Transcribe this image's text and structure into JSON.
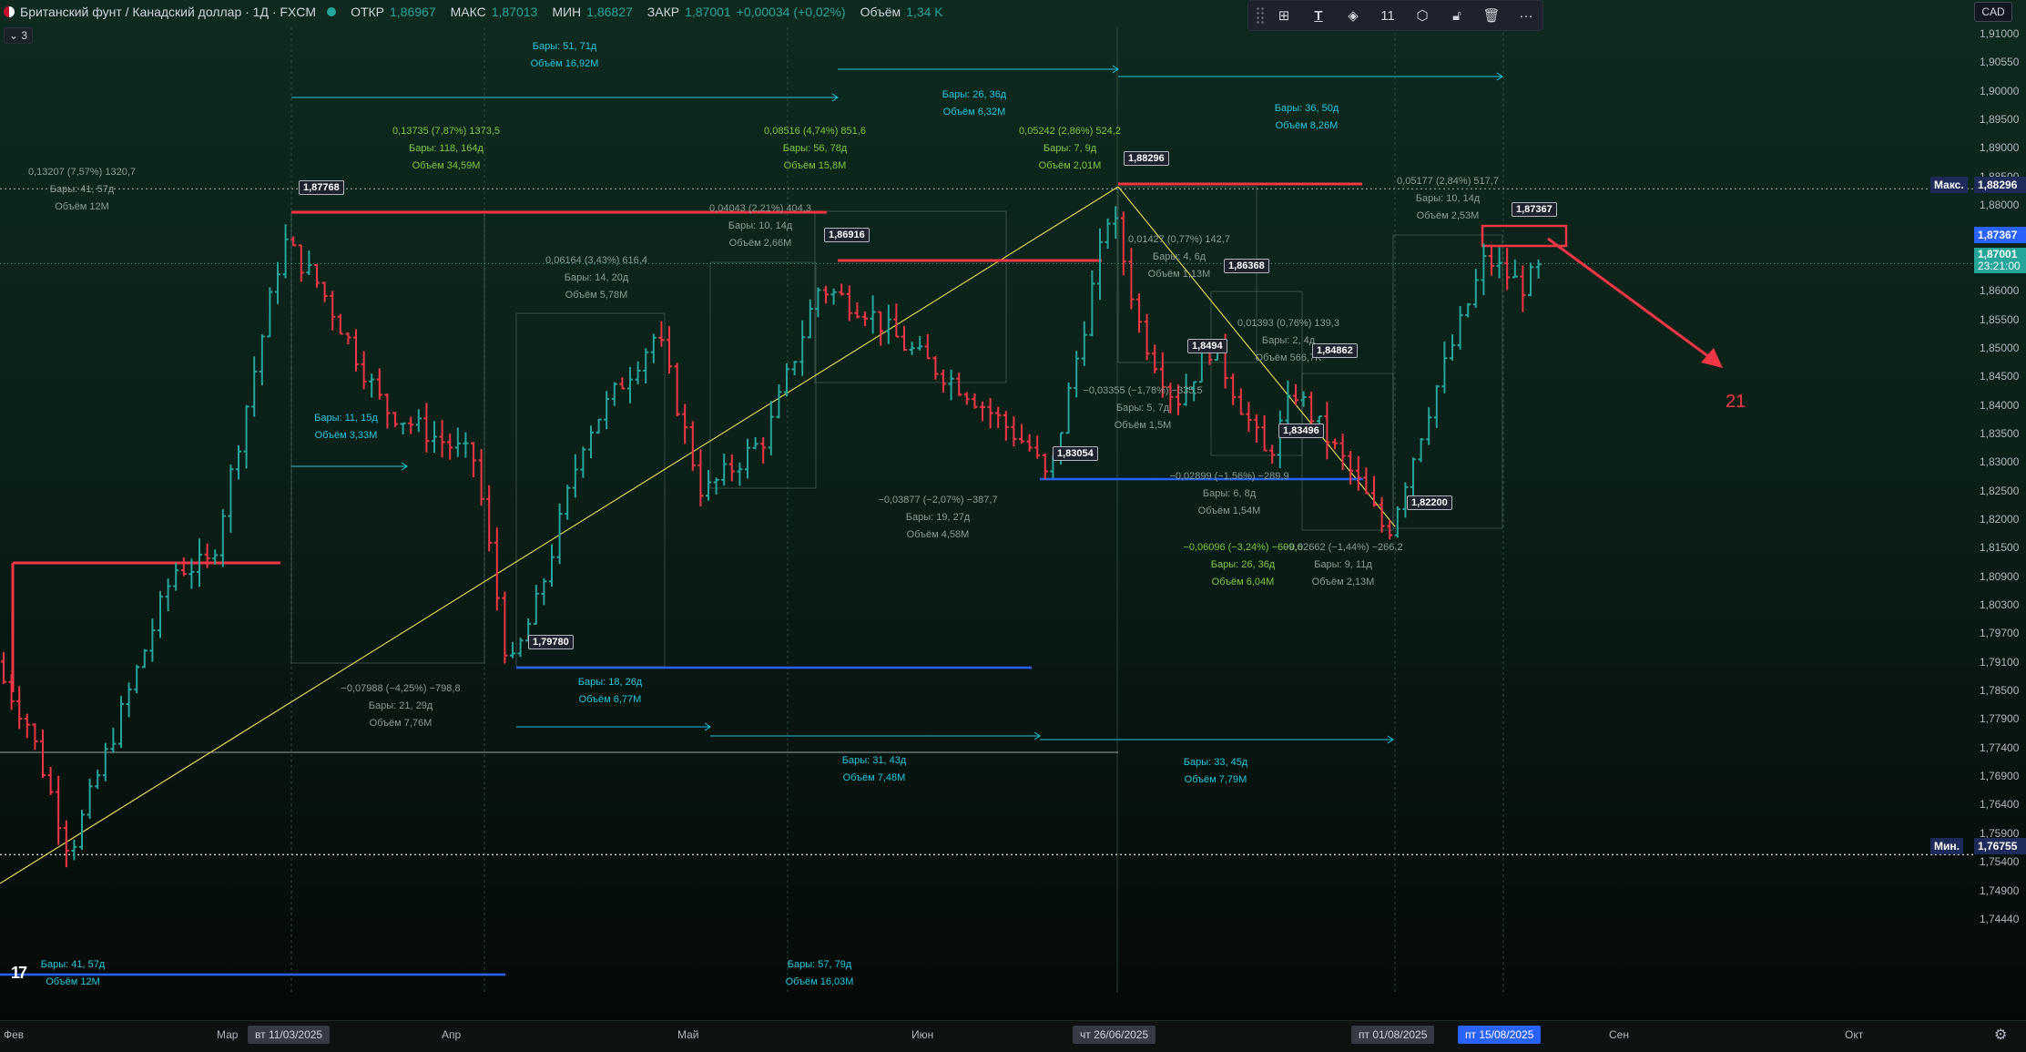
{
  "header": {
    "title": "Британский фунт / Канадский доллар · 1Д · FXCM",
    "open_label": "ОТКР",
    "open": "1,86967",
    "high_label": "МАКС",
    "high": "1,87013",
    "low_label": "МИН",
    "low": "1,86827",
    "close_label": "ЗАКР",
    "close": "1,87001",
    "change": "+0,00034 (+0,02%)",
    "volume_label": "Объём",
    "volume": "1,34 K",
    "indicator_count": "3"
  },
  "toolbar": {
    "count": "11",
    "icons": [
      "grip-icon",
      "template-icon",
      "text-tool-icon",
      "fill-icon",
      "line-width-icon",
      "settings-icon",
      "lock-icon",
      "trash-icon",
      "more-icon"
    ]
  },
  "price_scale": {
    "currency": "CAD",
    "ticks": [
      "1,91000",
      "1,90550",
      "1,90000",
      "1,89500",
      "1,89000",
      "1,88500",
      "1,88000",
      "1,87500",
      "1,86500",
      "1,86000",
      "1,85500",
      "1,85000",
      "1,84500",
      "1,84000",
      "1,83500",
      "1,83000",
      "1,82500",
      "1,82000",
      "1,81500",
      "1,80900",
      "1,80300",
      "1,79700",
      "1,79100",
      "1,78500",
      "1,77900",
      "1,77400",
      "1,76900",
      "1,76400",
      "1,75900",
      "1,75400",
      "1,74900",
      "1,74440"
    ],
    "max_label": "Макс.",
    "max_value": "1,88296",
    "min_label": "Мин.",
    "min_value": "1,76755",
    "current_price": "1,87001",
    "countdown": "23:21:00",
    "marked_price": "1,87367",
    "colors": {
      "current": "#26a69a",
      "marked": "#2962ff",
      "max": "#1e2a5a"
    }
  },
  "time_axis": {
    "labels": [
      "Фев",
      "Мар",
      "Апр",
      "Май",
      "Июн",
      "Сен",
      "Окт"
    ],
    "badges": [
      "вт 11/03/2025",
      "чт 26/06/2025",
      "пт 01/08/2025",
      "пт 15/08/2025"
    ]
  },
  "price_labels": [
    "1,87768",
    "1,86916",
    "1,88296",
    "1,86368",
    "1,8494",
    "1,84862",
    "1,83496",
    "1,83054",
    "1,82200",
    "1,79780",
    "1,87367"
  ],
  "annotations": {
    "a1": [
      "0,13207 (7,57%) 1320,7",
      "Бары: 41, 57д",
      "Объём 12M"
    ],
    "a2": [
      "0,13735 (7,87%) 1373,5",
      "Бары: 118, 164д",
      "Объём 34,59M"
    ],
    "a3": [
      "Бары: 51, 71д",
      "Объём 16,92M"
    ],
    "a4": [
      "0,08516 (4,74%) 851,6",
      "Бары: 56, 78д",
      "Объём 15,8M"
    ],
    "a5": [
      "Бары: 26, 36д",
      "Объём 6,32M"
    ],
    "a6": [
      "0,05242 (2,86%) 524,2",
      "Бары: 7, 9д",
      "Объём 2,01M"
    ],
    "a7": [
      "Бары: 36, 50д",
      "Объём 8,26M"
    ],
    "a8": [
      "0,05177 (2,84%) 517,7",
      "Бары: 10, 14д",
      "Объём 2,53M"
    ],
    "a9": [
      "0,04043 (2,21%) 404,3",
      "Бары: 10, 14д",
      "Объём 2,66M"
    ],
    "a10": [
      "0,06164 (3,43%) 616,4",
      "Бары: 14, 20д",
      "Объём 5,78M"
    ],
    "a11": [
      "0,01427 (0,77%) 142,7",
      "Бары: 4, 6д",
      "Объём 1,13M"
    ],
    "a12": [
      "0,01393 (0,76%) 139,3",
      "Бары: 2, 4д",
      "Объём 566,7K"
    ],
    "a13": [
      "Бары: 11, 15д",
      "Объём 3,33M"
    ],
    "a14": [
      "−0,03355 (−1,78%) −335,5",
      "Бары: 5, 7д",
      "Объём 1,5M"
    ],
    "a15": [
      "−0,03877 (−2,07%) −387,7",
      "Бары: 19, 27д",
      "Объём 4,58M"
    ],
    "a16": [
      "−0,02899 (−1,56%) −289,9",
      "Бары: 6, 8д",
      "Объём 1,54M"
    ],
    "a17": [
      "−0,06096 (−3,24%) −609,6",
      "Бары: 26, 36д",
      "Объём 6,04M"
    ],
    "a18": [
      "−0,02662 (−1,44%) −266,2",
      "Бары: 9, 11д",
      "Объём 2,13M"
    ],
    "a19": [
      "−0,07988 (−4,25%) −798,8",
      "Бары: 21, 29д",
      "Объём 7,76M"
    ],
    "a20": [
      "Бары: 18, 26д",
      "Объём 6,77M"
    ],
    "a21": [
      "Бары: 31, 43д",
      "Объём 7,48M"
    ],
    "a22": [
      "Бары: 33, 45д",
      "Объём 7,79M"
    ],
    "a23": [
      "Бары: 41, 57д",
      "Объём 12M"
    ],
    "a24": [
      "Бары: 57, 79д",
      "Объём 16,03M"
    ]
  },
  "drawing_label": "21",
  "logo": "17",
  "colors": {
    "up": "#26a69a",
    "down": "#f23645",
    "hline_red": "#f23645",
    "hline_blue": "#2962ff",
    "trend": "#e3d45a",
    "arrow": "#f23645"
  }
}
